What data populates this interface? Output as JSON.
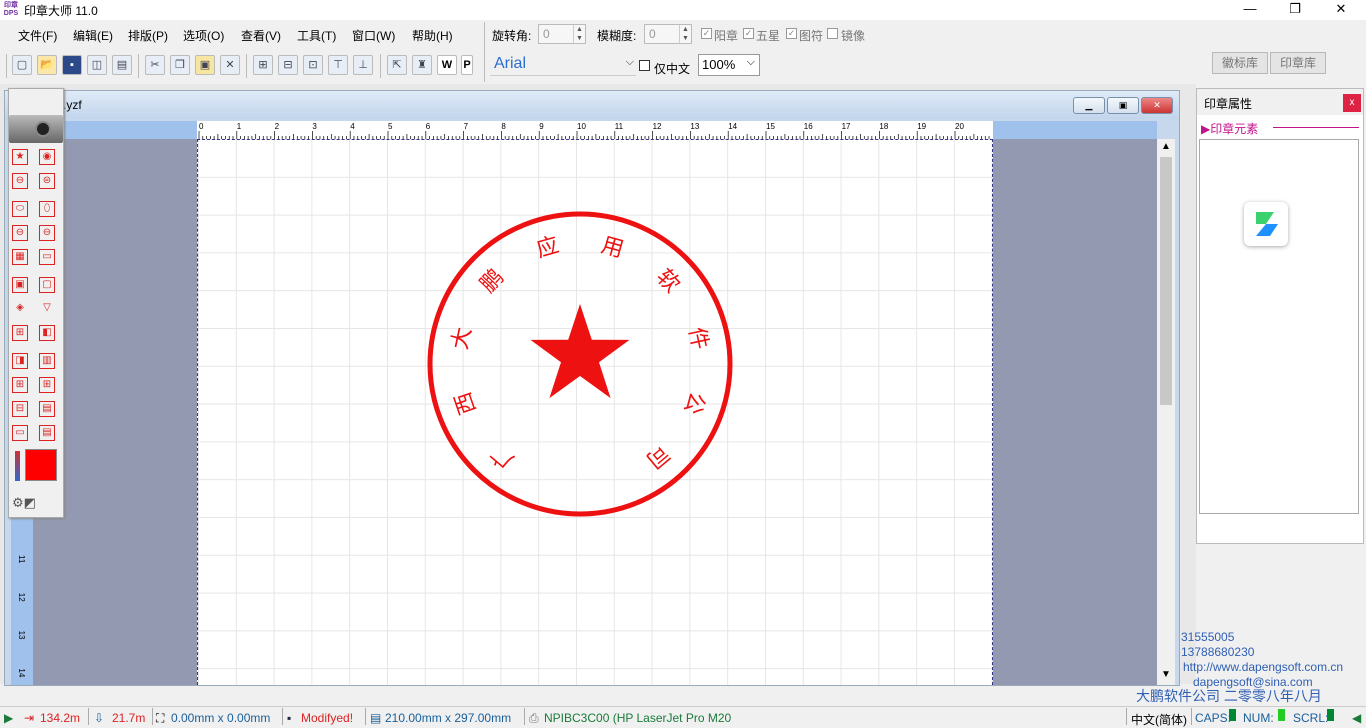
{
  "app": {
    "title": "印章大师 11.0",
    "icon_text": "印章 DPS"
  },
  "window_controls": {
    "minimize": "—",
    "maximize": "❐",
    "close": "✕"
  },
  "menu": [
    "文件(F)",
    "编辑(E)",
    "排版(P)",
    "选项(O)",
    "查看(V)",
    "工具(T)",
    "窗口(W)",
    "帮助(H)"
  ],
  "toolbar_icons": [
    "new-icon",
    "open-icon",
    "save-icon",
    "preview-icon",
    "print-icon",
    "cut-icon",
    "copy-icon",
    "paste-icon",
    "delete-icon",
    "align-icon",
    "align-left-icon",
    "align-right-icon",
    "align-top-icon",
    "align-bottom-icon",
    "export-icon",
    "stamp-icon",
    "word-icon",
    "pdf-icon"
  ],
  "props_toolbar": {
    "rotate_label": "旋转角:",
    "rotate_value": "0",
    "blur_label": "模糊度:",
    "blur_value": "0",
    "yang_label": "阳章",
    "five_star_label": "五星",
    "graphic_label": "图符",
    "mirror_label": "镜像",
    "font": "Arial",
    "chinese_only_label": "仅中文",
    "zoom": "100%"
  },
  "library_tabs": [
    "徽标库",
    "印章库"
  ],
  "document": {
    "title": ".yzf",
    "ruler_h": [
      "0",
      "1",
      "2",
      "3",
      "4",
      "5",
      "6",
      "7",
      "8",
      "9",
      "10",
      "11",
      "12",
      "13",
      "14",
      "15",
      "16",
      "17",
      "18",
      "19",
      "20"
    ],
    "ruler_v": [
      "11",
      "12",
      "13",
      "14"
    ]
  },
  "stamp": {
    "color": "#ee1111",
    "chars": [
      "广",
      "西",
      "大",
      "鹏",
      "应",
      "用",
      "软",
      "件",
      "公",
      "司"
    ]
  },
  "property_panel": {
    "title": "印章属性",
    "close": "x",
    "section": "印章元素"
  },
  "contact": {
    "line1": "31555005",
    "line2": "13788680230",
    "line3": "http://www.dapengsoft.com.cn",
    "line4": "dapengsoft@sina.com",
    "company": "大鹏软件公司 二零零八年八月"
  },
  "status": {
    "pos_x": "134.2m",
    "pos_y": "21.7m",
    "size": "0.00mm x 0.00mm",
    "modified": "Modifyed!",
    "paper": "210.00mm x 297.00mm",
    "printer": "NPIBC3C00 (HP LaserJet Pro M20",
    "ime": "中文(简体)",
    "caps": "CAPS:",
    "num": "NUM:",
    "scrl": "SCRL:"
  }
}
